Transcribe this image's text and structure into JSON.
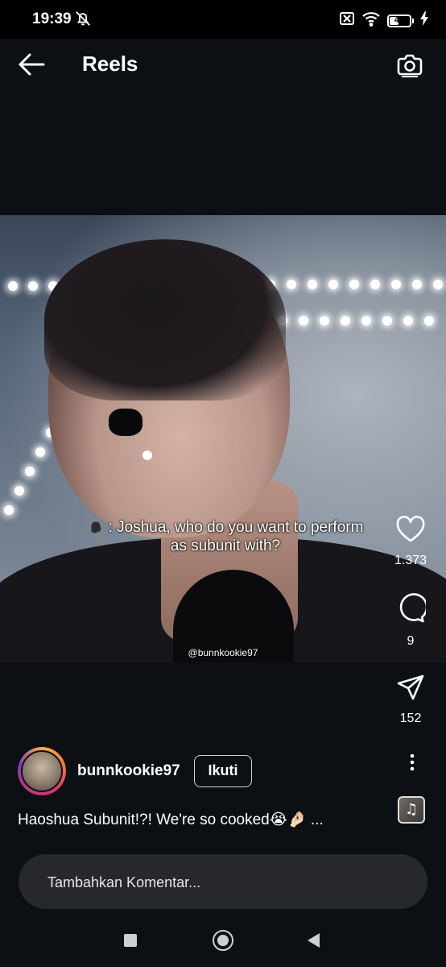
{
  "status_bar": {
    "time": "19:39",
    "battery": "46",
    "battery_level": 0.46
  },
  "header": {
    "title": "Reels"
  },
  "video": {
    "caption_line1": ": Joshua, who do you want to perform",
    "caption_line2": "as subunit with?",
    "watermark": "@bunnkookie97"
  },
  "actions": {
    "likes": "1.373",
    "comments": "9",
    "shares": "152"
  },
  "author": {
    "username": "bunnkookie97",
    "follow_label": "Ikuti"
  },
  "post": {
    "description": "Haoshua Subunit!?! We're so cooked😭🤌🏻 ..."
  },
  "comment": {
    "placeholder": "Tambahkan Komentar..."
  },
  "icons": {
    "back": "arrow-left-icon",
    "camera": "camera-icon",
    "like": "heart-icon",
    "comment": "speech-bubble-icon",
    "share": "paper-plane-icon",
    "more": "vertical-dots-icon",
    "music": "music-note-icon",
    "muted_bell": "bell-off-icon",
    "wifi": "wifi-icon",
    "sim": "sim-off-icon",
    "charging": "bolt-icon"
  }
}
